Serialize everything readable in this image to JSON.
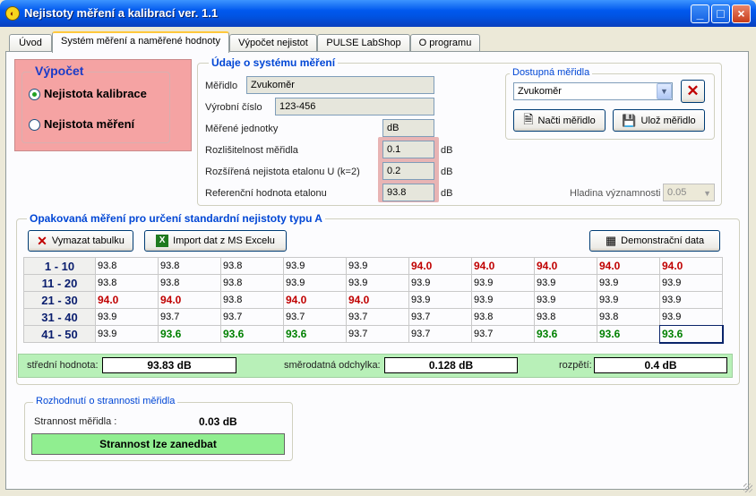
{
  "window": {
    "title": "Nejistoty měření a kalibrací  ver. 1.1",
    "app_icon": "measure-app-icon",
    "controls": {
      "minimize": "_",
      "maximize": "□",
      "close": "×"
    }
  },
  "tabs": [
    {
      "label": "Úvod",
      "active": false
    },
    {
      "label": "Systém měření a naměřené hodnoty",
      "active": true
    },
    {
      "label": "Výpočet nejistot",
      "active": false
    },
    {
      "label": "PULSE LabShop",
      "active": false
    },
    {
      "label": "O programu",
      "active": false
    }
  ],
  "vypocet": {
    "title": "Výpočet",
    "options": [
      {
        "label": "Nejistota kalibrace",
        "selected": true
      },
      {
        "label": "Nejistota měření",
        "selected": false
      }
    ]
  },
  "system": {
    "title": "Údaje o systému měření",
    "meridlo_label": "Měřidlo",
    "meridlo_value": "Zvukoměr",
    "vyrobni_label": "Výrobní číslo",
    "vyrobni_value": "123-456",
    "jednotky_label": "Měřené jednotky",
    "jednotky_value": "dB",
    "rozlisitelnost_label": "Rozlišitelnost měřidla",
    "rozlisitelnost_value": "0.1",
    "rozlisitelnost_unit": "dB",
    "rozsirena_label": "Rozšířená nejistota etalonu U (k=2)",
    "rozsirena_value": "0.2",
    "rozsirena_unit": "dB",
    "referencni_label": "Referenční hodnota etalonu",
    "referencni_value": "93.8",
    "referencni_unit": "dB",
    "hladina_label": "Hladina významnosti",
    "hladina_value": "0.05"
  },
  "meridla": {
    "title": "Dostupná měřidla",
    "selected": "Zvukoměr",
    "load_label": "Načti měřidlo",
    "save_label": "Ulož měřidlo"
  },
  "opakovana": {
    "title": "Opakovaná měření pro určení standardní nejistoty typu A",
    "clear_label": "Vymazat tabulku",
    "import_label": "Import dat z MS Excelu",
    "demo_label": "Demonstrační data",
    "rows": [
      {
        "header": "1 - 10",
        "values": [
          "93.8",
          "93.8",
          "93.8",
          "93.9",
          "93.9",
          "94.0",
          "94.0",
          "94.0",
          "94.0",
          "94.0"
        ]
      },
      {
        "header": "11 - 20",
        "values": [
          "93.8",
          "93.8",
          "93.8",
          "93.9",
          "93.9",
          "93.9",
          "93.9",
          "93.9",
          "93.9",
          "93.9"
        ]
      },
      {
        "header": "21 - 30",
        "values": [
          "94.0",
          "94.0",
          "93.8",
          "94.0",
          "94.0",
          "93.9",
          "93.9",
          "93.9",
          "93.9",
          "93.9"
        ]
      },
      {
        "header": "31 - 40",
        "values": [
          "93.9",
          "93.7",
          "93.7",
          "93.7",
          "93.7",
          "93.7",
          "93.8",
          "93.8",
          "93.8",
          "93.9"
        ]
      },
      {
        "header": "41 - 50",
        "values": [
          "93.9",
          "93.6",
          "93.6",
          "93.6",
          "93.7",
          "93.7",
          "93.7",
          "93.6",
          "93.6",
          "93.6"
        ]
      }
    ],
    "highlight": {
      "max_value": "94.0",
      "min_value": "93.6",
      "max_color": "#c00000",
      "min_color": "#008000"
    },
    "stats": {
      "mean_label": "střední hodnota:",
      "mean_value": "93.83 dB",
      "std_label": "směrodatná odchylka:",
      "std_value": "0.128 dB",
      "range_label": "rozpětí:",
      "range_value": "0.4 dB"
    }
  },
  "strannost": {
    "title": "Rozhodnutí o strannosti měřidla",
    "label": "Strannost měřidla  :",
    "value": "0.03 dB",
    "verdict": "Strannost lze zanedbat"
  }
}
